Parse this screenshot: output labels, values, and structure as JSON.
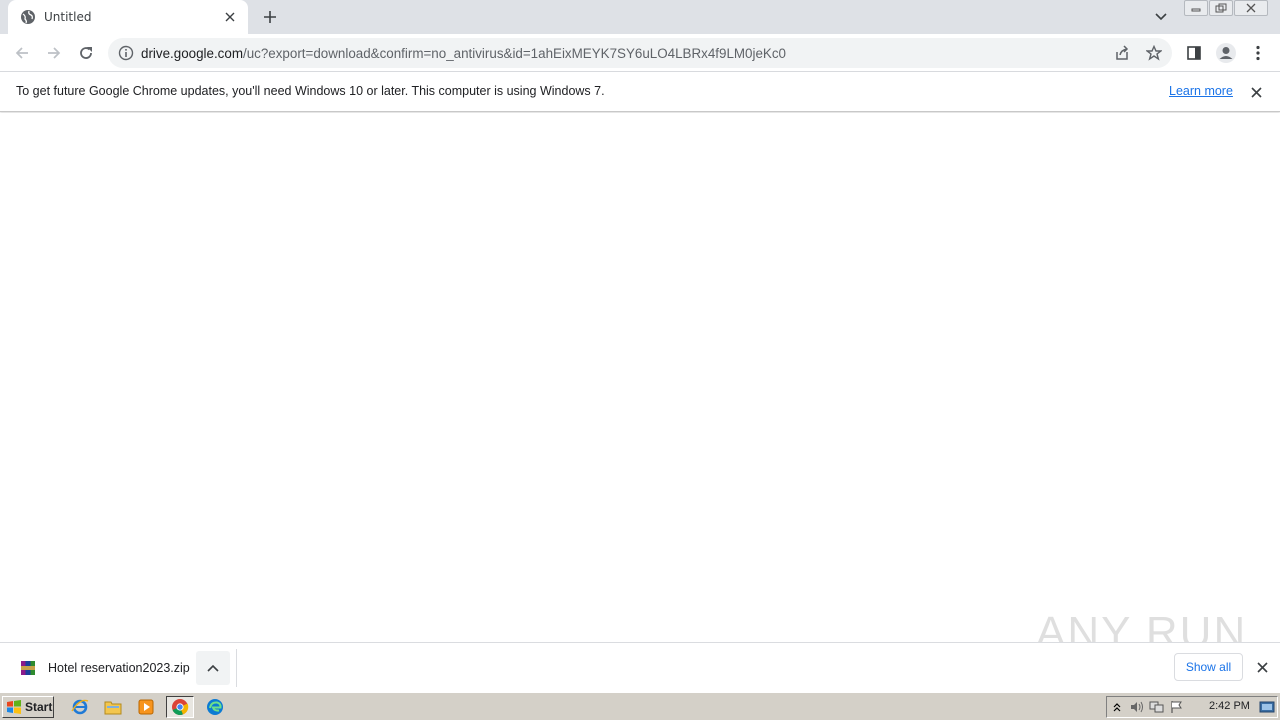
{
  "browser": {
    "tab": {
      "title": "Untitled",
      "icon": "globe-icon"
    },
    "address": {
      "host": "drive.google.com",
      "path": "/uc?export=download&confirm=no_antivirus&id=1ahEixMEYK7SY6uLO4LBRx4f9LM0jeKc0"
    }
  },
  "infobar": {
    "message": "To get future Google Chrome updates, you'll need Windows 10 or later. This computer is using Windows 7.",
    "link": "Learn more"
  },
  "watermark": "ANY RUN",
  "downloads": {
    "items": [
      {
        "name": "Hotel reservation2023.zip",
        "icon": "winrar-zip-icon"
      }
    ],
    "show_all": "Show all"
  },
  "taskbar": {
    "start_label": "Start",
    "clock": "2:42 PM",
    "apps": [
      "internet-explorer",
      "file-explorer",
      "media-player",
      "chrome",
      "edge"
    ]
  },
  "colors": {
    "accent": "#1a73e8",
    "tabstrip": "#dee1e6",
    "taskbar": "#d4d0c8"
  }
}
